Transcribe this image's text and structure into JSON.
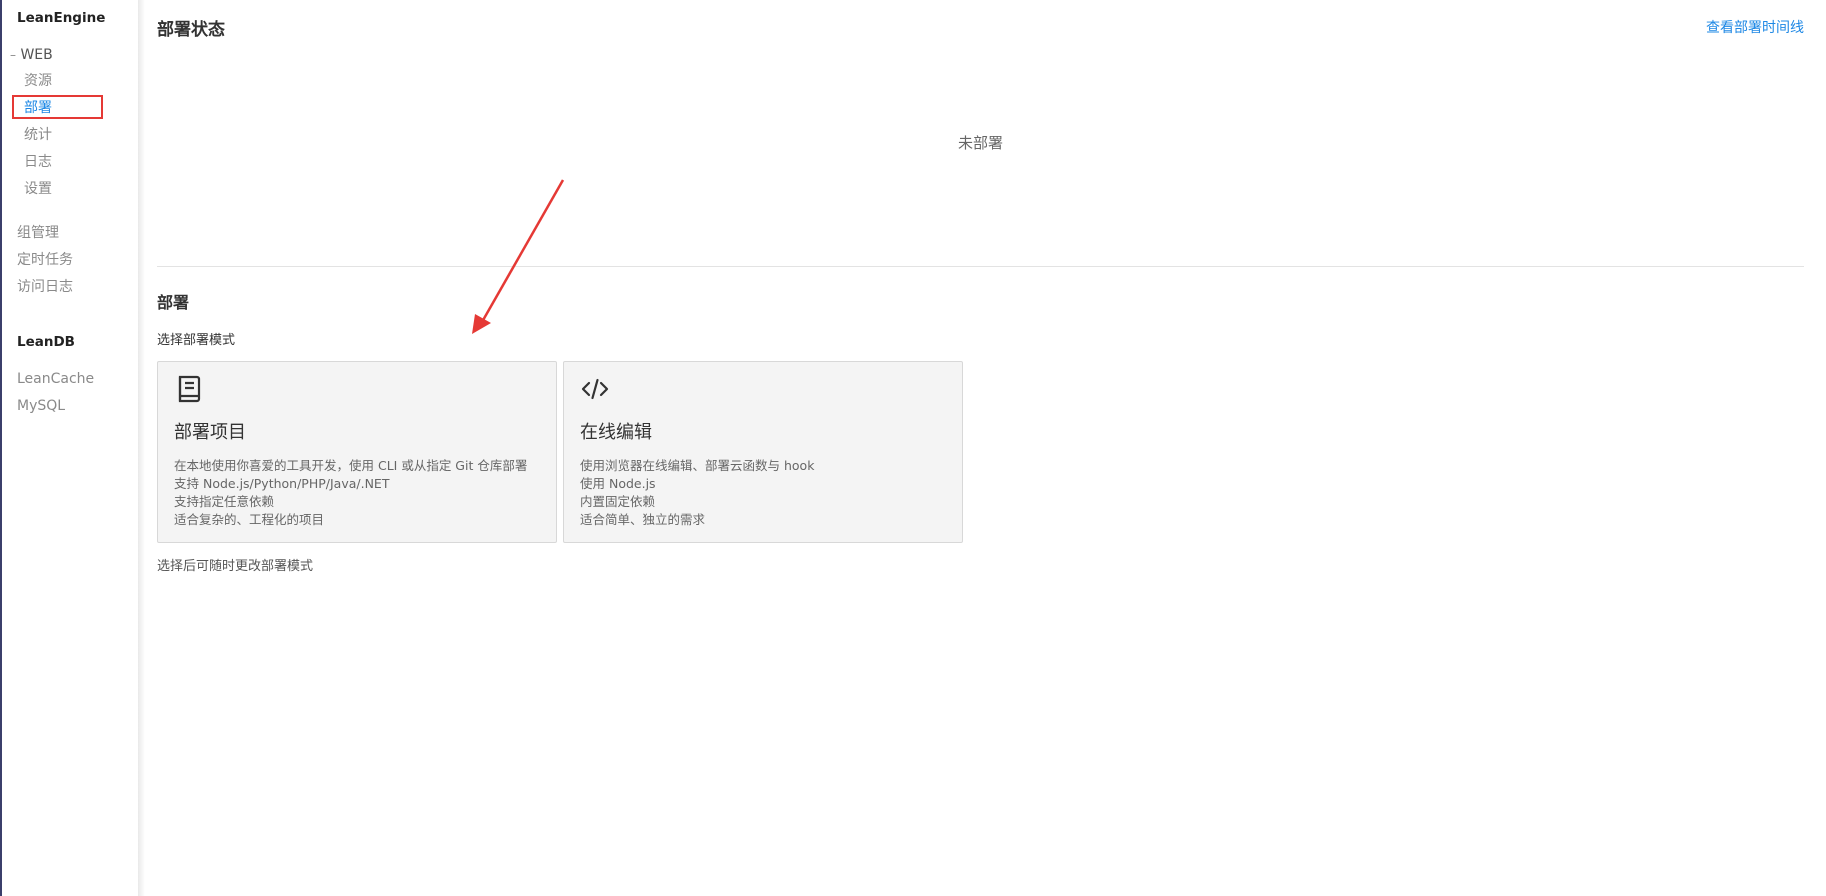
{
  "sidebar": {
    "leanengine_label": "LeanEngine",
    "web_label": "WEB",
    "web_prefix": "–",
    "web_items": [
      {
        "label": "资源"
      },
      {
        "label": "部署"
      },
      {
        "label": "统计"
      },
      {
        "label": "日志"
      },
      {
        "label": "设置"
      }
    ],
    "other_items": [
      {
        "label": "组管理"
      },
      {
        "label": "定时任务"
      },
      {
        "label": "访问日志"
      }
    ],
    "leandb_label": "LeanDB",
    "db_items": [
      {
        "label": "LeanCache"
      },
      {
        "label": "MySQL"
      }
    ],
    "active_item": "部署"
  },
  "main": {
    "status_title": "部署状态",
    "timeline_link": "查看部署时间线",
    "status_empty": "未部署",
    "deploy_title": "部署",
    "mode_label": "选择部署模式",
    "cards": [
      {
        "icon": "book-icon",
        "title": "部署项目",
        "lines": [
          "在本地使用你喜爱的工具开发，使用 CLI 或从指定 Git 仓库部署",
          "支持 Node.js/Python/PHP/Java/.NET",
          "支持指定任意依赖",
          "适合复杂的、工程化的项目"
        ]
      },
      {
        "icon": "code-icon",
        "title": "在线编辑",
        "lines": [
          "使用浏览器在线编辑、部署云函数与 hook",
          "使用 Node.js",
          "内置固定依赖",
          "适合简单、独立的需求"
        ]
      }
    ],
    "footnote": "选择后可随时更改部署模式"
  },
  "colors": {
    "accent": "#1e88e5",
    "annotation": "#e53935"
  }
}
